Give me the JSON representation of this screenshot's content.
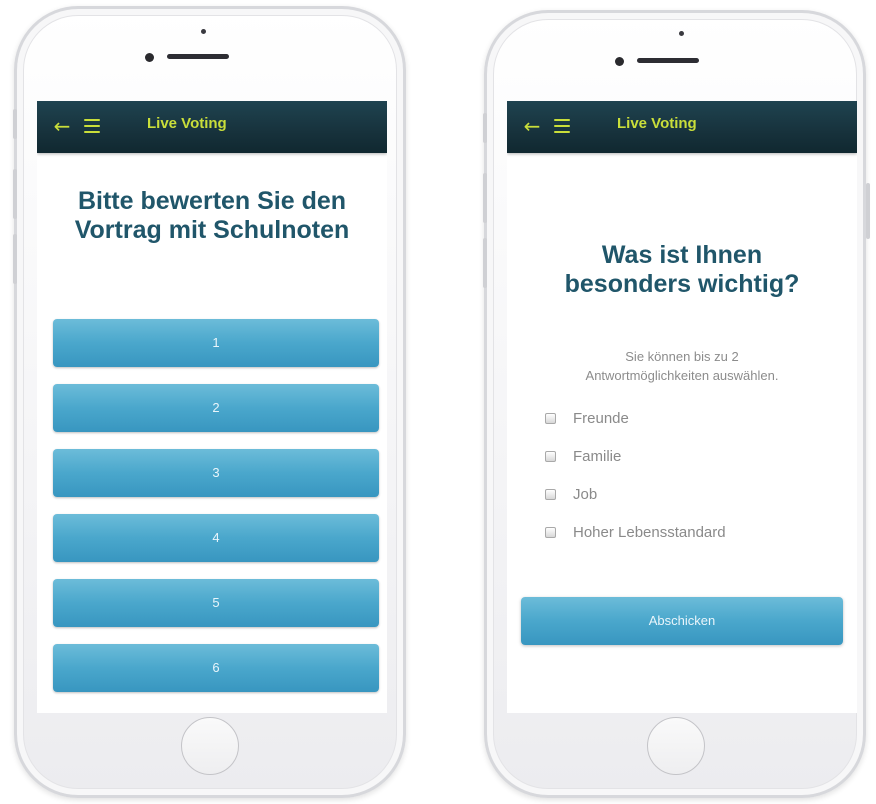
{
  "left_phone": {
    "header": {
      "title": "Live Voting",
      "back_icon": "arrow-left-icon",
      "menu_icon": "hamburger-menu-icon"
    },
    "question": "Bitte bewerten Sie den Vortrag mit Schulnoten",
    "options": [
      "1",
      "2",
      "3",
      "4",
      "5",
      "6"
    ]
  },
  "right_phone": {
    "header": {
      "title": "Live Voting",
      "back_icon": "arrow-left-icon",
      "menu_icon": "hamburger-menu-icon"
    },
    "question": "Was ist Ihnen besonders wichtig?",
    "hint": "Sie können bis zu 2 Antwortmöglichkeiten auswählen.",
    "options": [
      "Freunde",
      "Familie",
      "Job",
      "Hoher Lebensstandard"
    ],
    "submit_label": "Abschicken"
  },
  "colors": {
    "header_bg": "#17323c",
    "header_accent": "#c9de3a",
    "title_text": "#20566a",
    "button": "#4aa7cc"
  }
}
